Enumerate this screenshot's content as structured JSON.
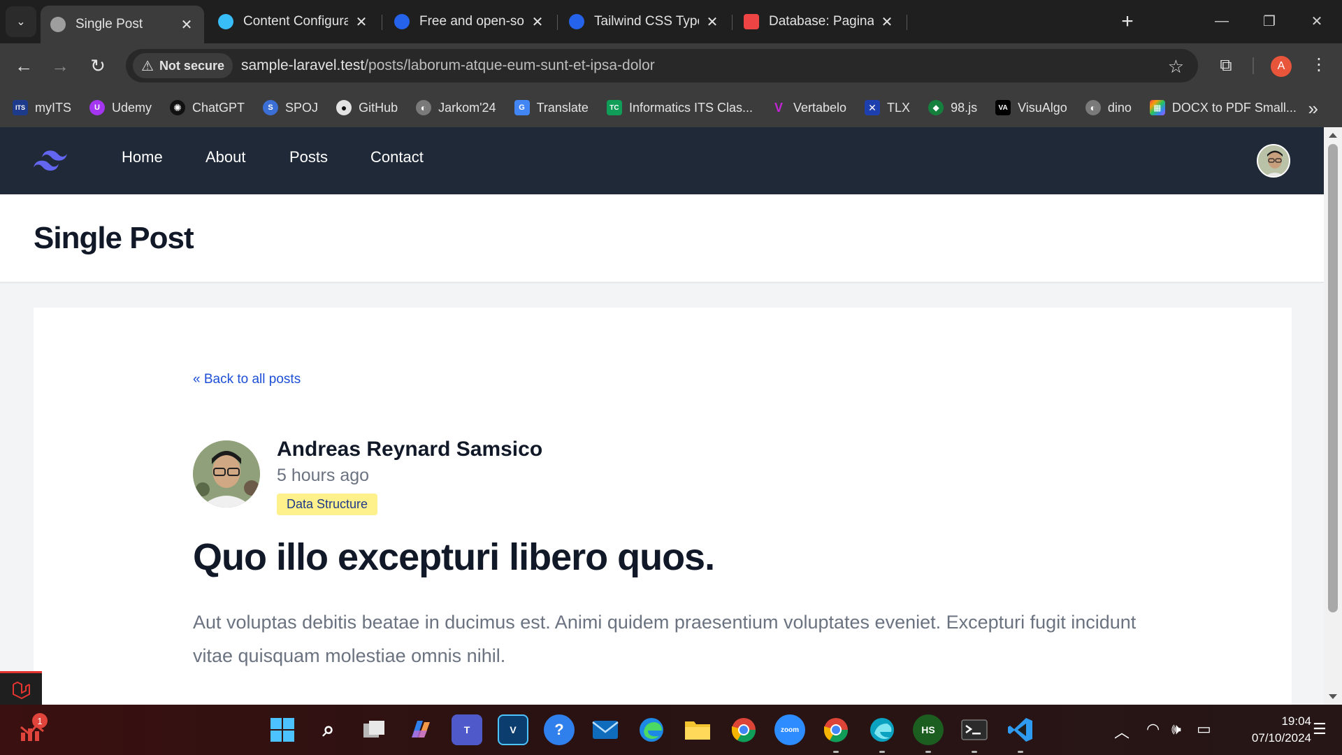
{
  "browser": {
    "tabs": [
      {
        "title": "Single Post",
        "icon_color": "#9e9e9e",
        "active": true
      },
      {
        "title": "Content Configuration - ",
        "icon_color": "#38bdf8",
        "active": false
      },
      {
        "title": "Free and open-source SV",
        "icon_color": "#2563eb",
        "active": false
      },
      {
        "title": "Tailwind CSS Typography",
        "icon_color": "#2563eb",
        "active": false
      },
      {
        "title": "Database: Pagination - La",
        "icon_color": "#ef4444",
        "active": false
      }
    ],
    "close_glyph": "✕",
    "new_tab_glyph": "+",
    "address": {
      "security_label": "Not secure",
      "host": "sample-laravel.test",
      "path": "/posts/laborum-atque-eum-sunt-et-ipsa-dolor"
    },
    "profile_initial": "A",
    "bookmarks": [
      {
        "label": "myITS",
        "icon": "ITS",
        "color": "#1e3a8a"
      },
      {
        "label": "Udemy",
        "icon": "U",
        "color": "#a435f0"
      },
      {
        "label": "ChatGPT",
        "icon": "✺",
        "color": "#111111"
      },
      {
        "label": "SPOJ",
        "icon": "S",
        "color": "#3b6fd6"
      },
      {
        "label": "GitHub",
        "icon": "●",
        "color": "#111111"
      },
      {
        "label": "Jarkom'24",
        "icon": "◐",
        "color": "#7a7a7a"
      },
      {
        "label": "Translate",
        "icon": "G",
        "color": "#4285f4"
      },
      {
        "label": "Informatics ITS Clas...",
        "icon": "TC",
        "color": "#0f9d58"
      },
      {
        "label": "Vertabelo",
        "icon": "V",
        "color": "#c026d3"
      },
      {
        "label": "TLX",
        "icon": "✕",
        "color": "#1e40af"
      },
      {
        "label": "98.js",
        "icon": "◆",
        "color": "#15803d"
      },
      {
        "label": "VisuAlgo",
        "icon": "VA",
        "color": "#000000"
      },
      {
        "label": "dino",
        "icon": "◐",
        "color": "#7a7a7a"
      },
      {
        "label": "DOCX to PDF Small...",
        "icon": "▦",
        "color": "#f59e0b"
      }
    ]
  },
  "site": {
    "nav_links": [
      "Home",
      "About",
      "Posts",
      "Contact"
    ],
    "page_title": "Single Post",
    "post": {
      "back_link": "« Back to all posts",
      "author": "Andreas Reynard Samsico",
      "time": "5 hours ago",
      "category": "Data Structure",
      "title": "Quo illo excepturi libero quos.",
      "body": "Aut voluptas debitis beatae in ducimus est. Animi quidem praesentium voluptates eveniet. Excepturi fugit incidunt vitae quisquam molestiae omnis nihil."
    }
  },
  "taskbar": {
    "notification_count": "1",
    "apps": [
      "windows-start-icon",
      "search-icon",
      "task-view-icon",
      "copilot-icon",
      "teams-icon",
      "visual-paradigm-icon",
      "tips-icon",
      "mail-icon",
      "edge-icon",
      "file-explorer-icon",
      "chrome-icon",
      "zoom-icon",
      "chrome-profile-icon",
      "edge-dev-icon",
      "hackerspace-icon",
      "terminal-icon",
      "vscode-icon"
    ],
    "zoom_label": "zoom",
    "hs_label": "HS",
    "time": "19:04",
    "date": "07/10/2024"
  },
  "colors": {
    "nav_bg": "#1f2937",
    "link": "#1d4ed8",
    "badge_bg": "#fef08a",
    "badge_text": "#1e3a8a"
  }
}
